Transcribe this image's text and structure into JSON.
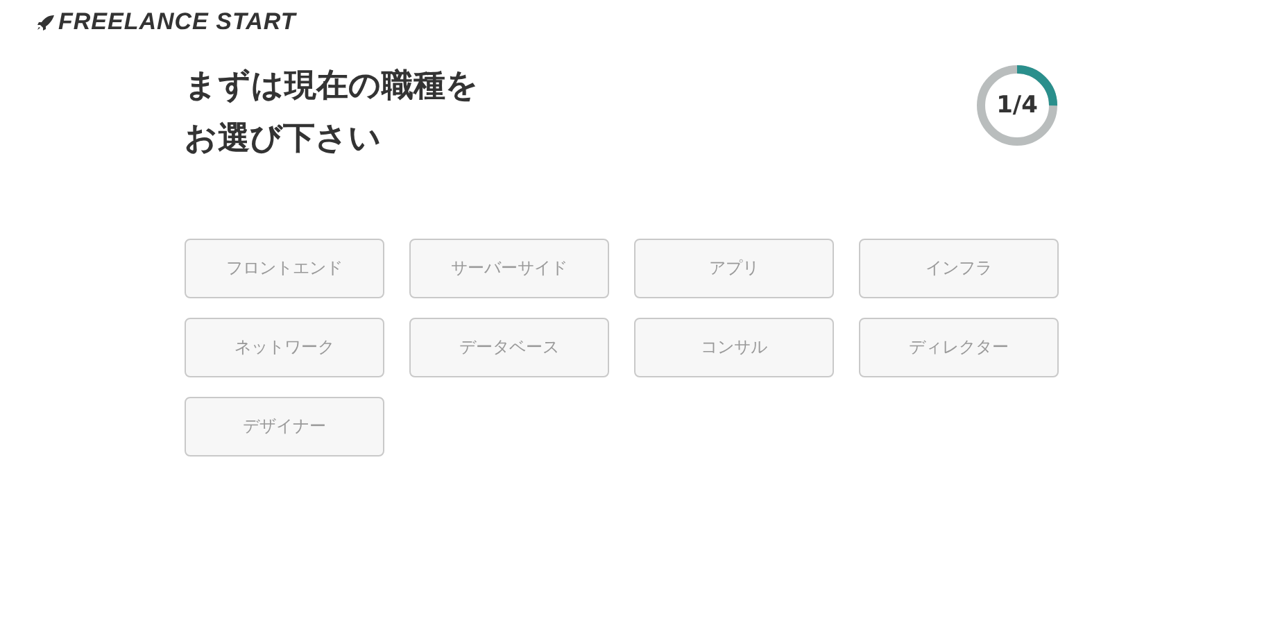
{
  "logo": {
    "text": "FREELANCE START"
  },
  "heading": {
    "lines": [
      "まずは現在の職種を",
      "お選び下さい"
    ]
  },
  "progress": {
    "text": "1/4",
    "level": 0.25
  },
  "options": [
    {
      "label": "フロントエンド",
      "selected": false
    },
    {
      "label": "サーバーサイド",
      "selected": false
    },
    {
      "label": "アプリ",
      "selected": false
    },
    {
      "label": "インフラ",
      "selected": false
    },
    {
      "label": "ネットワーク",
      "selected": false
    },
    {
      "label": "データベース",
      "selected": false
    },
    {
      "label": "コンサル",
      "selected": false
    },
    {
      "label": "ディレクター",
      "selected": false
    },
    {
      "label": "デザイナー",
      "selected": false
    }
  ]
}
